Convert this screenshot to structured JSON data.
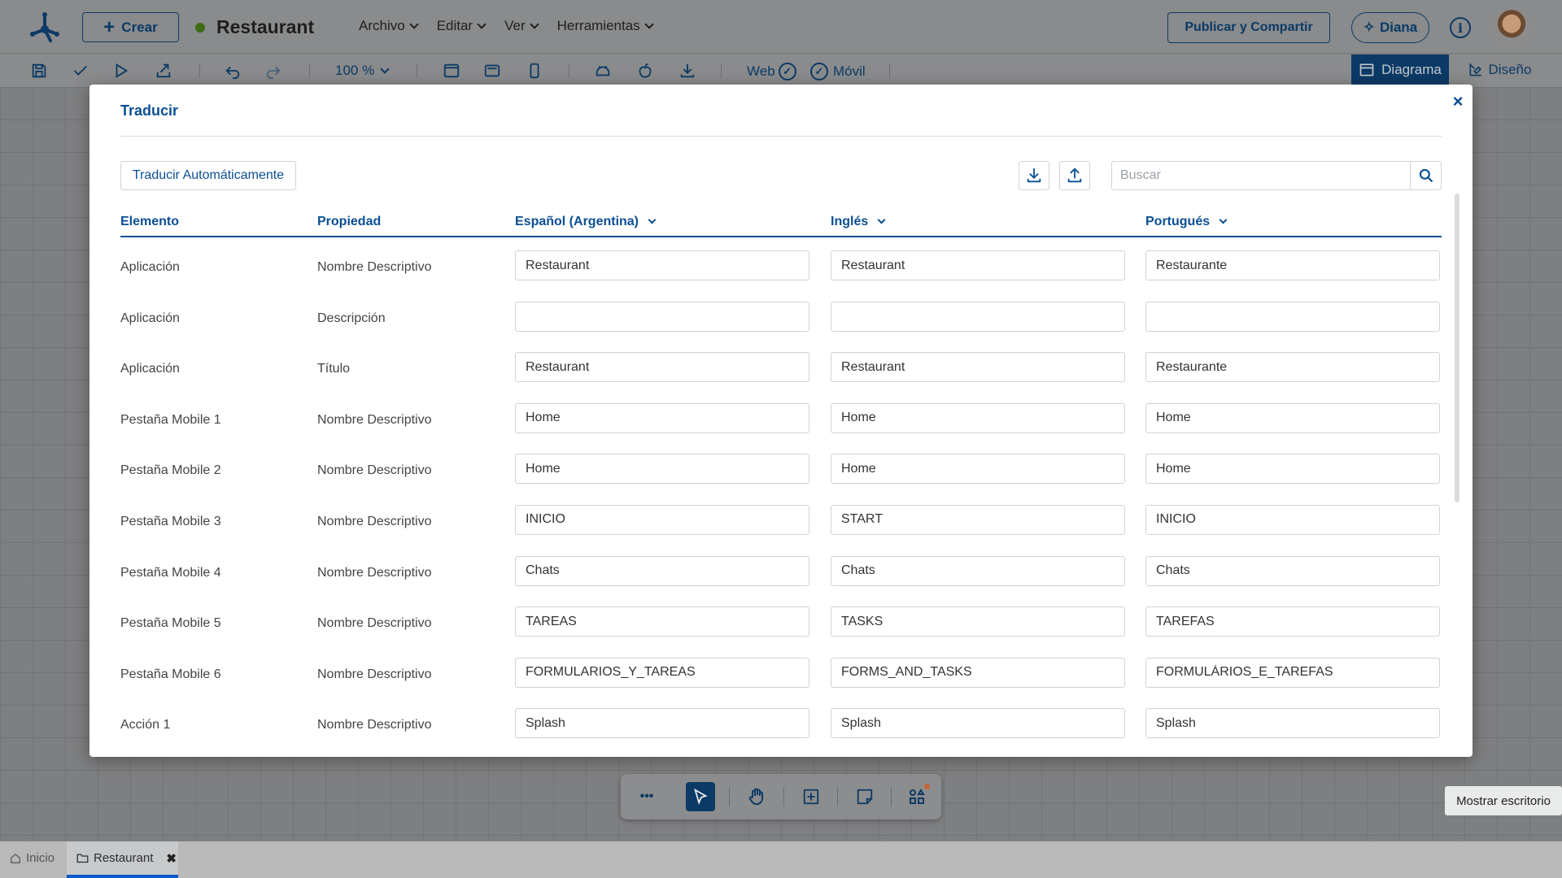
{
  "header": {
    "create_label": "Crear",
    "app_name": "Restaurant",
    "menus": [
      "Archivo",
      "Editar",
      "Ver",
      "Herramientas"
    ],
    "publish_label": "Publicar y Compartir",
    "diana_label": "Diana",
    "info_icon": "i"
  },
  "toolbar": {
    "zoom": "100 %",
    "web_label": "Web",
    "movil_label": "Móvil",
    "diagram_tab": "Diagrama",
    "design_tab": "Diseño"
  },
  "modal": {
    "title": "Traducir",
    "close_icon": "×",
    "auto_translate_label": "Traducir Automáticamente",
    "search_placeholder": "Buscar",
    "columns": {
      "element": "Elemento",
      "property": "Propiedad",
      "lang1": "Español (Argentina)",
      "lang2": "Inglés",
      "lang3": "Portugués"
    },
    "rows": [
      {
        "element": "Aplicación",
        "property": "Nombre Descriptivo",
        "es": "Restaurant",
        "en": "Restaurant",
        "pt": "Restaurante"
      },
      {
        "element": "Aplicación",
        "property": "Descripción",
        "es": "",
        "en": "",
        "pt": ""
      },
      {
        "element": "Aplicación",
        "property": "Título",
        "es": "Restaurant",
        "en": "Restaurant",
        "pt": "Restaurante"
      },
      {
        "element": "Pestaña Mobile 1",
        "property": "Nombre Descriptivo",
        "es": "Home",
        "en": "Home",
        "pt": "Home"
      },
      {
        "element": "Pestaña Mobile 2",
        "property": "Nombre Descriptivo",
        "es": "Home",
        "en": "Home",
        "pt": "Home"
      },
      {
        "element": "Pestaña Mobile 3",
        "property": "Nombre Descriptivo",
        "es": "INICIO",
        "en": "START",
        "pt": "INICIO"
      },
      {
        "element": "Pestaña Mobile 4",
        "property": "Nombre Descriptivo",
        "es": "Chats",
        "en": "Chats",
        "pt": "Chats"
      },
      {
        "element": "Pestaña Mobile 5",
        "property": "Nombre Descriptivo",
        "es": "TAREAS",
        "en": "TASKS",
        "pt": "TAREFAS"
      },
      {
        "element": "Pestaña Mobile 6",
        "property": "Nombre Descriptivo",
        "es": "FORMULARIOS_Y_TAREAS",
        "en": "FORMS_AND_TASKS",
        "pt": "FORMULÁRIOS_E_TAREFAS"
      },
      {
        "element": "Acción 1",
        "property": "Nombre Descriptivo",
        "es": "Splash",
        "en": "Splash",
        "pt": "Splash"
      }
    ]
  },
  "canvas": {
    "tooltip": "Mostrar escritorio",
    "more_icon": "•••"
  },
  "tabs": {
    "home_label": "Inicio",
    "current_label": "Restaurant",
    "close_icon": "✖"
  },
  "colors": {
    "brand": "#0b4f93",
    "dark_brand": "#0b3a66",
    "status_green": "#3c6b14",
    "active_tab_underline": "#0c59c6"
  }
}
